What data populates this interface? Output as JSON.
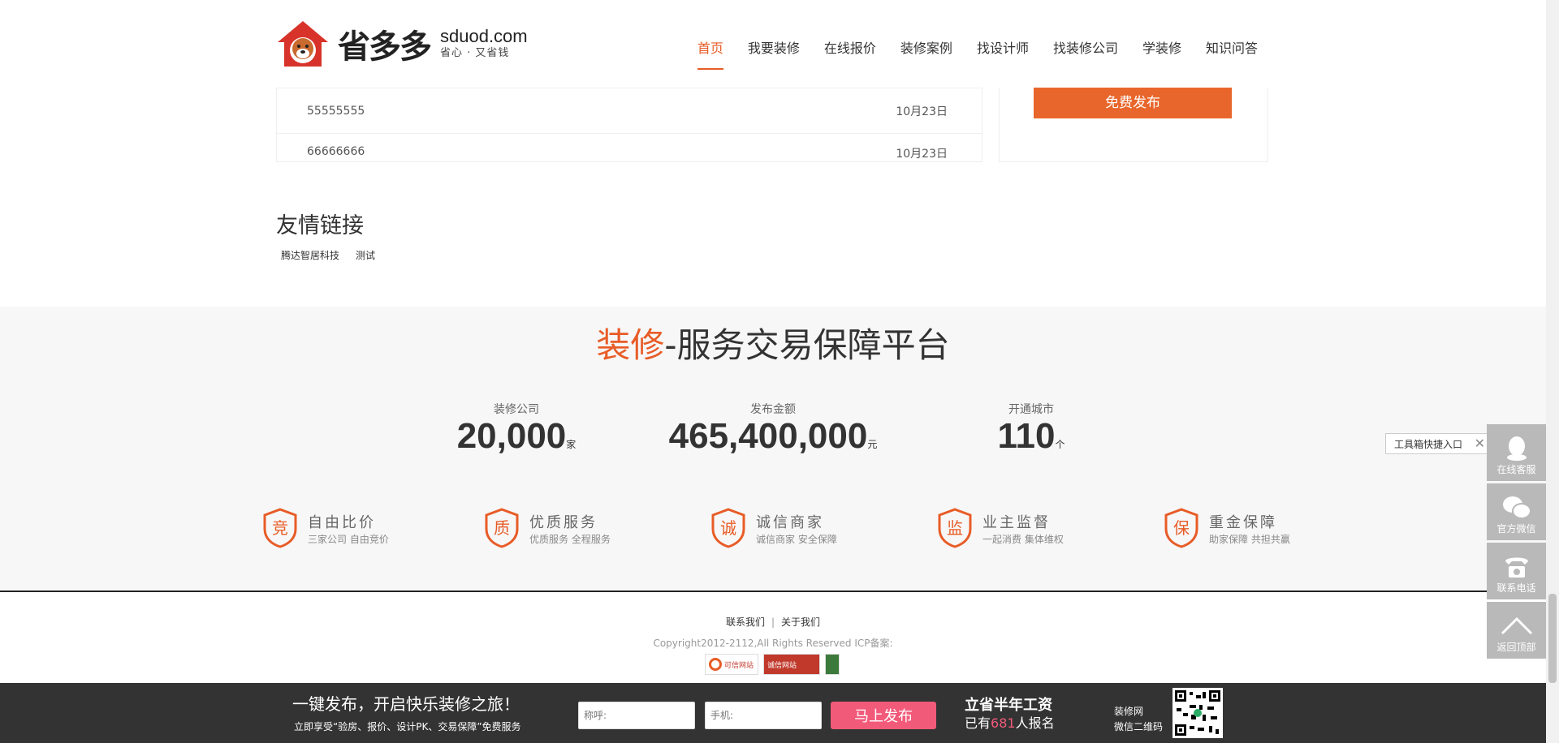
{
  "header": {
    "logo_cn": "省多多",
    "logo_domain": "sduod.com",
    "logo_slogan": "省心 · 又省钱",
    "nav": [
      "首页",
      "我要装修",
      "在线报价",
      "装修案例",
      "找设计师",
      "找装修公司",
      "学装修",
      "知识问答"
    ],
    "active_nav": "首页"
  },
  "list": [
    {
      "title": "55555555",
      "date": "10月23日"
    },
    {
      "title": "66666666",
      "date": "10月23日"
    }
  ],
  "publish_button": "免费发布",
  "friend_links": {
    "title": "友情链接",
    "items": [
      "腾达智居科技",
      "测试"
    ]
  },
  "platform": {
    "slogan_highlight": "装修",
    "slogan_rest": "-服务交易保障平台",
    "stats": [
      {
        "label": "装修公司",
        "value": "20,000",
        "unit": "家"
      },
      {
        "label": "发布金额",
        "value": "465,400,000",
        "unit": "元"
      },
      {
        "label": "开通城市",
        "value": "110",
        "unit": "个"
      }
    ],
    "features": [
      {
        "icon_char": "竞",
        "title": "自由比价",
        "sub": "三家公司 自由竞价"
      },
      {
        "icon_char": "质",
        "title": "优质服务",
        "sub": "优质服务 全程服务"
      },
      {
        "icon_char": "诚",
        "title": "诚信商家",
        "sub": "诚信商家 安全保障"
      },
      {
        "icon_char": "监",
        "title": "业主监督",
        "sub": "一起消费 集体维权"
      },
      {
        "icon_char": "保",
        "title": "重金保障",
        "sub": "助家保障 共担共赢"
      }
    ]
  },
  "footer": {
    "contact": "联系我们",
    "sep": "|",
    "about": "关于我们",
    "copyright": "Copyright2012-2112,All Rights Reserved ICP备案:",
    "badges": [
      "可信网站",
      "诚信网站"
    ]
  },
  "bottom_bar": {
    "title": "一键发布，开启快乐装修之旅！",
    "sub": "立即享受“验房、报价、设计PK、交易保障”免费服务",
    "name_placeholder": "称呼:",
    "phone_placeholder": "手机:",
    "button": "马上发布",
    "promo_line1": "立省半年工资",
    "promo_prefix": "已有",
    "promo_count": "681",
    "promo_suffix": "人报名",
    "qr_line1": "装修网",
    "qr_line2": "微信二维码"
  },
  "toolbar": {
    "tip": "工具箱快捷入口",
    "tip_close": "✕",
    "items": [
      {
        "label": "在线客服",
        "icon": "qq-icon"
      },
      {
        "label": "官方微信",
        "icon": "wechat-icon"
      },
      {
        "label": "联系电话",
        "icon": "phone-icon"
      },
      {
        "label": "返回顶部",
        "icon": "arrow-up-icon"
      }
    ]
  },
  "colors": {
    "accent": "#e85c27",
    "publish_btn": "#e8662b",
    "pink_btn": "#f25a7a",
    "bottom_bar": "#333333",
    "toolbar": "#b9b9b9"
  }
}
